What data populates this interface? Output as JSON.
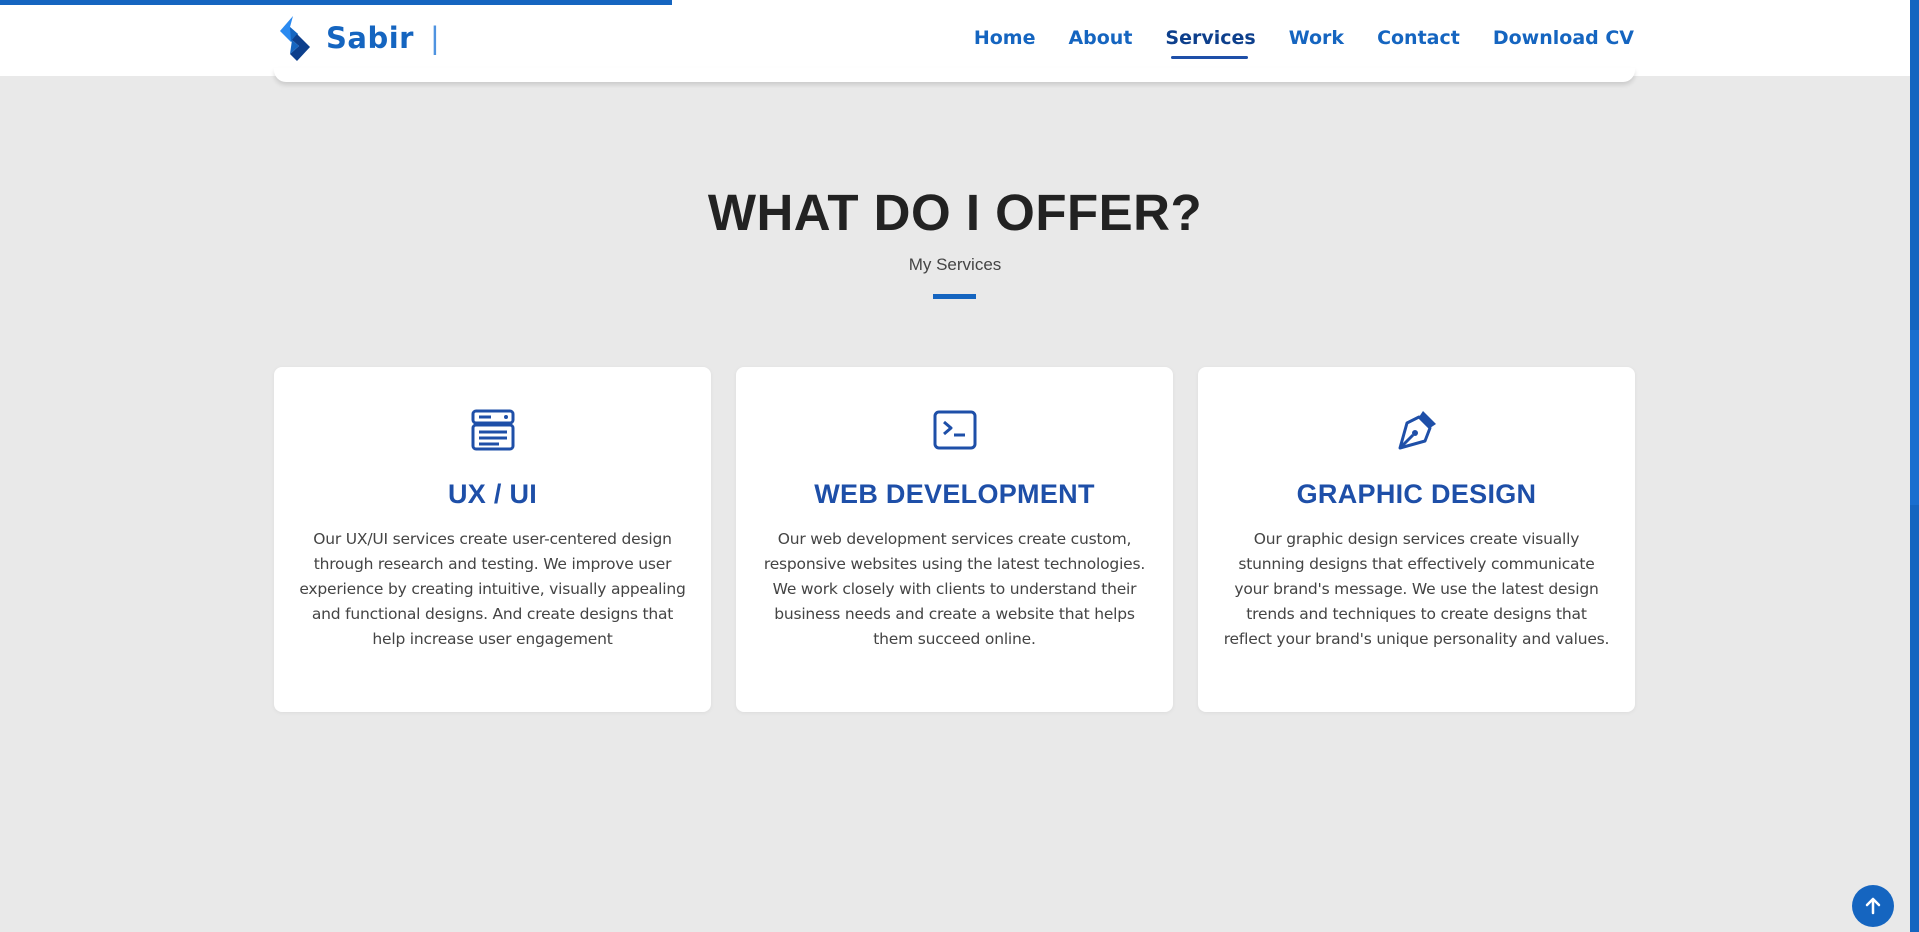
{
  "scroll_progress_percent": 35,
  "brand": {
    "name": "Sabir",
    "cursor": "|",
    "logo_icon": "diamond-logo-icon"
  },
  "nav": {
    "items": [
      {
        "label": "Home"
      },
      {
        "label": "About"
      },
      {
        "label": "Services",
        "active": true
      },
      {
        "label": "Work"
      },
      {
        "label": "Contact"
      },
      {
        "label": "Download CV"
      }
    ]
  },
  "services": {
    "title": "WHAT DO I OFFER?",
    "subtitle": "My Services",
    "cards": [
      {
        "icon": "server-stack-icon",
        "title": "UX / UI",
        "description": "Our UX/UI services create user-centered design through research and testing. We improve user experience by creating intuitive, visually appealing and functional designs. And create designs that help increase user engagement"
      },
      {
        "icon": "terminal-icon",
        "title": "WEB DEVELOPMENT",
        "description": "Our web development services create custom, responsive websites using the latest technologies. We work closely with clients to understand their business needs and create a website that helps them succeed online."
      },
      {
        "icon": "pen-nib-icon",
        "title": "GRAPHIC DESIGN",
        "description": "Our graphic design services create visually stunning designs that effectively communicate your brand's message. We use the latest design trends and techniques to create designs that reflect your brand's unique personality and values."
      }
    ]
  },
  "scroll_top_button": {
    "icon": "arrow-up-icon"
  },
  "colors": {
    "accent": "#1565c0",
    "heading_blue": "#1e4fa8",
    "background": "#e9e9e9",
    "card": "#ffffff",
    "title_text": "#222222"
  }
}
